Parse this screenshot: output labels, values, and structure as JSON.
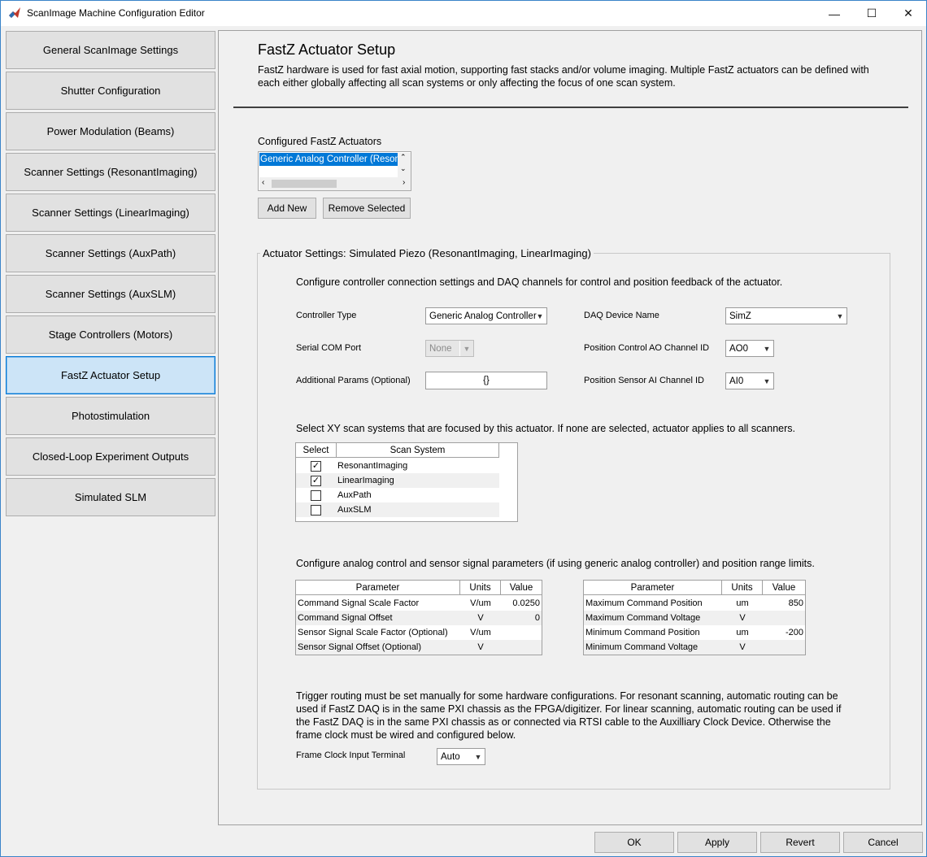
{
  "window": {
    "title": "ScanImage Machine Configuration Editor"
  },
  "sidebar": {
    "items": [
      {
        "label": "General ScanImage Settings"
      },
      {
        "label": "Shutter Configuration"
      },
      {
        "label": "Power Modulation (Beams)"
      },
      {
        "label": "Scanner Settings (ResonantImaging)"
      },
      {
        "label": "Scanner Settings (LinearImaging)"
      },
      {
        "label": "Scanner Settings (AuxPath)"
      },
      {
        "label": "Scanner Settings (AuxSLM)"
      },
      {
        "label": "Stage Controllers (Motors)"
      },
      {
        "label": "FastZ Actuator Setup"
      },
      {
        "label": "Photostimulation"
      },
      {
        "label": "Closed-Loop Experiment Outputs"
      },
      {
        "label": "Simulated SLM"
      }
    ]
  },
  "page": {
    "title": "FastZ Actuator Setup",
    "description": "FastZ hardware is used for fast axial motion, supporting fast stacks and/or volume imaging. Multiple FastZ actuators can be defined with each either globally affecting all scan systems or only affecting the focus of one scan system."
  },
  "actuators": {
    "label": "Configured FastZ Actuators",
    "selected": "Generic Analog Controller (Resonant",
    "add_label": "Add New",
    "remove_label": "Remove Selected"
  },
  "settings": {
    "title": "Actuator Settings: Simulated Piezo (ResonantImaging, LinearImaging)",
    "intro": "Configure controller connection settings and DAQ channels for control and position feedback of the actuator.",
    "controller_type_label": "Controller Type",
    "controller_type_value": "Generic Analog Controller",
    "serial_com_label": "Serial COM Port",
    "serial_com_value": "None",
    "additional_params_label": "Additional Params (Optional)",
    "additional_params_value": "{}",
    "daq_device_label": "DAQ Device Name",
    "daq_device_value": "SimZ",
    "ao_channel_label": "Position Control AO Channel ID",
    "ao_channel_value": "AO0",
    "ai_channel_label": "Position Sensor AI Channel ID",
    "ai_channel_value": "AI0"
  },
  "scan_systems": {
    "intro": "Select XY scan systems that are focused by this actuator. If none are selected, actuator applies to all scanners.",
    "col_select": "Select",
    "col_system": "Scan System",
    "rows": [
      {
        "name": "ResonantImaging",
        "checked": true
      },
      {
        "name": "LinearImaging",
        "checked": true
      },
      {
        "name": "AuxPath",
        "checked": false
      },
      {
        "name": "AuxSLM",
        "checked": false
      }
    ]
  },
  "analog": {
    "intro": "Configure analog control and sensor signal parameters (if using generic analog controller) and position range limits.",
    "col_param": "Parameter",
    "col_units": "Units",
    "col_value": "Value",
    "signal_rows": [
      {
        "param": "Command Signal Scale Factor",
        "units": "V/um",
        "value": "0.0250"
      },
      {
        "param": "Command Signal Offset",
        "units": "V",
        "value": "0"
      },
      {
        "param": "Sensor Signal Scale Factor (Optional)",
        "units": "V/um",
        "value": ""
      },
      {
        "param": "Sensor Signal Offset (Optional)",
        "units": "V",
        "value": ""
      }
    ],
    "limit_rows": [
      {
        "param": "Maximum Command Position",
        "units": "um",
        "value": "850"
      },
      {
        "param": "Maximum Command Voltage",
        "units": "V",
        "value": ""
      },
      {
        "param": "Minimum Command Position",
        "units": "um",
        "value": "-200"
      },
      {
        "param": "Minimum Command Voltage",
        "units": "V",
        "value": ""
      }
    ]
  },
  "trigger": {
    "text": "Trigger routing must be set manually for some hardware configurations. For resonant scanning, automatic routing can be used if FastZ DAQ is in the same PXI chassis as the FPGA/digitizer. For linear scanning, automatic routing can be used if the FastZ DAQ is in the same PXI chassis as or connected via RTSI cable to the Auxilliary Clock Device. Otherwise the frame clock must be wired and configured below.",
    "frame_clock_label": "Frame Clock Input Terminal",
    "frame_clock_value": "Auto"
  },
  "footer": {
    "ok": "OK",
    "apply": "Apply",
    "revert": "Revert",
    "cancel": "Cancel"
  }
}
